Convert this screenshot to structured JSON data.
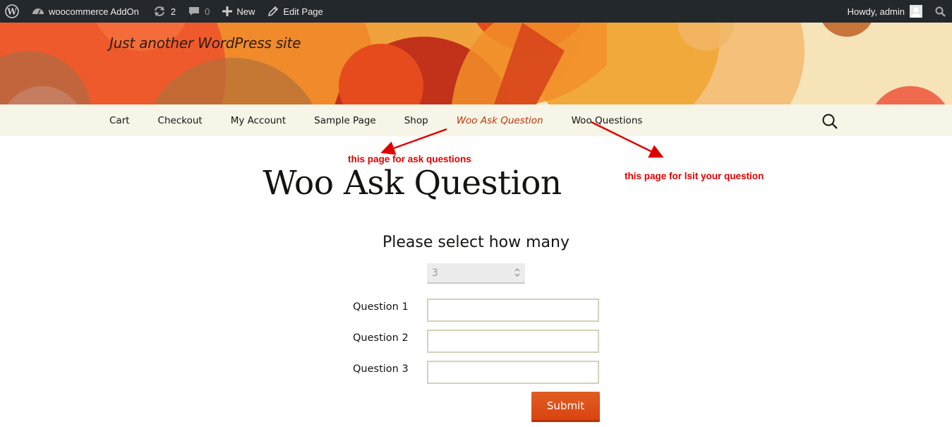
{
  "admin_bar": {
    "site_name": "woocommerce AddOn",
    "updates_count": "2",
    "comments_count": "0",
    "new_label": "New",
    "edit_label": "Edit Page",
    "greeting": "Howdy, admin",
    "icons": [
      "wordpress-icon",
      "dashboard-icon",
      "updates-icon",
      "comments-icon",
      "plus-icon",
      "pencil-icon",
      "avatar",
      "search-icon"
    ]
  },
  "site": {
    "tagline": "Just another WordPress site"
  },
  "nav": {
    "items": [
      {
        "label": "Cart"
      },
      {
        "label": "Checkout"
      },
      {
        "label": "My Account"
      },
      {
        "label": "Sample Page"
      },
      {
        "label": "Shop"
      },
      {
        "label": "Woo Ask Question",
        "current": true
      },
      {
        "label": "Woo Questions"
      }
    ]
  },
  "annotations": {
    "ask": "this page for ask questions",
    "list": "this page for lsit your question",
    "color": "#e00000"
  },
  "page": {
    "title": "Woo Ask Question",
    "form_heading": "Please select how many",
    "count_value": "3",
    "questions": [
      {
        "label": "Question 1",
        "value": ""
      },
      {
        "label": "Question 2",
        "value": ""
      },
      {
        "label": "Question 3",
        "value": ""
      }
    ],
    "submit_label": "Submit"
  },
  "colors": {
    "admin_bar": "#23282d",
    "nav_bg": "#f7f5e7",
    "accent": "#bc360a",
    "button": "#e05d22"
  }
}
